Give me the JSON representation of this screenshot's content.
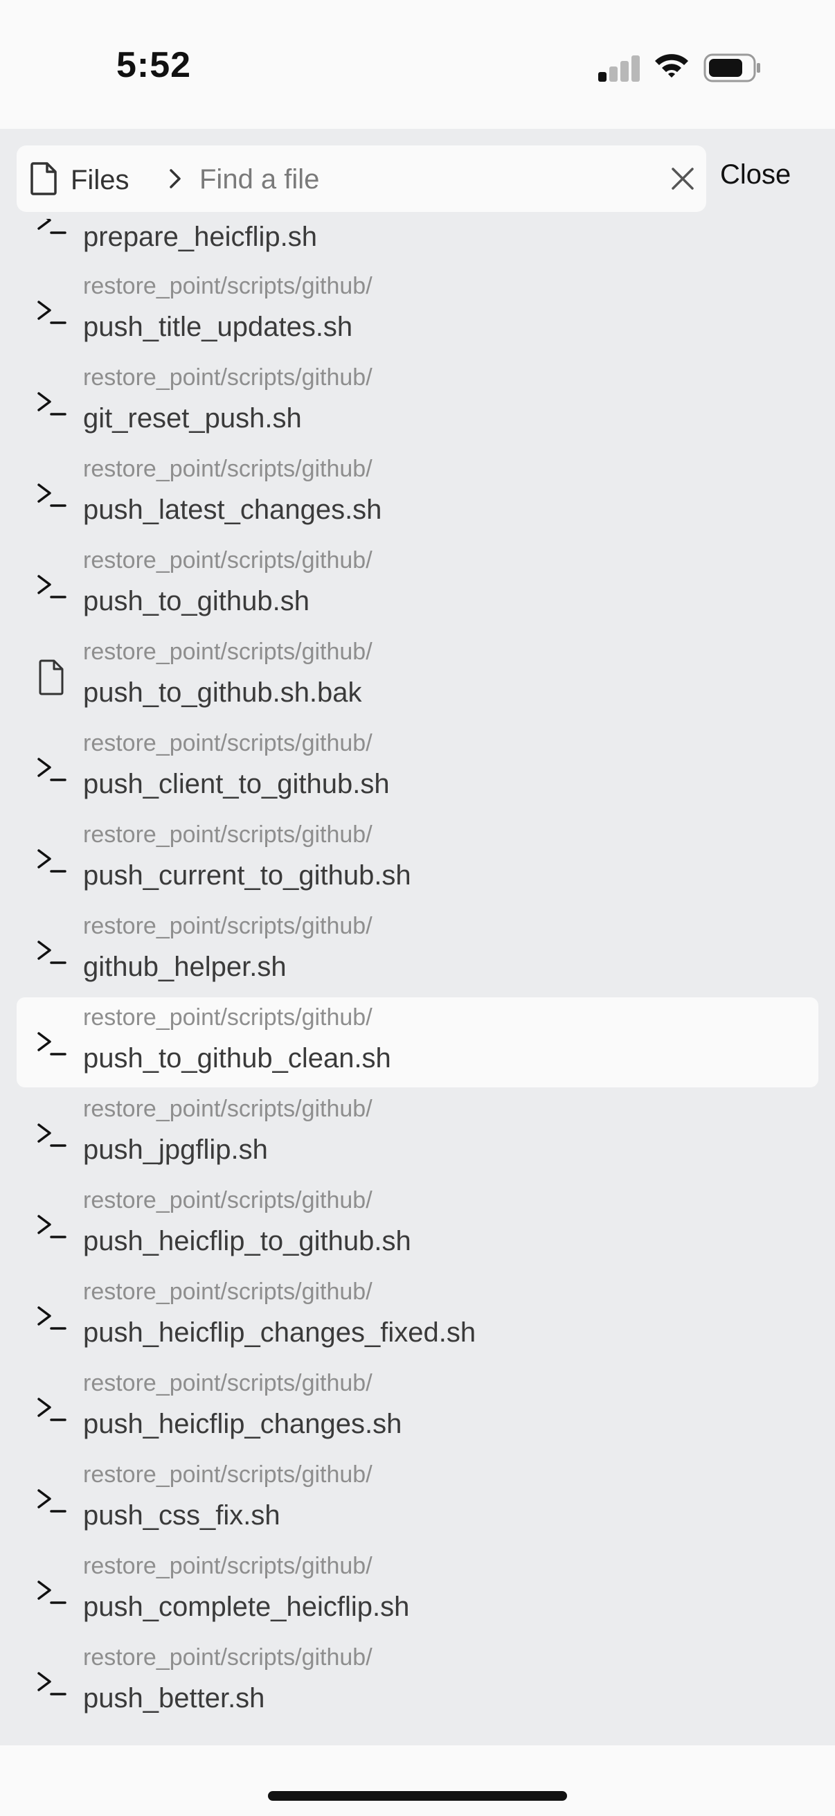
{
  "status_bar": {
    "time": "5:52"
  },
  "search": {
    "files_label": "Files",
    "placeholder": "Find a file",
    "close_label": "Close"
  },
  "list": {
    "first_name": "prepare_heicflip.sh",
    "items": [
      {
        "path": "restore_point/scripts/github/",
        "name": "push_title_updates.sh",
        "icon": "terminal-icon"
      },
      {
        "path": "restore_point/scripts/github/",
        "name": "git_reset_push.sh",
        "icon": "terminal-icon"
      },
      {
        "path": "restore_point/scripts/github/",
        "name": "push_latest_changes.sh",
        "icon": "terminal-icon"
      },
      {
        "path": "restore_point/scripts/github/",
        "name": "push_to_github.sh",
        "icon": "terminal-icon"
      },
      {
        "path": "restore_point/scripts/github/",
        "name": "push_to_github.sh.bak",
        "icon": "file-icon"
      },
      {
        "path": "restore_point/scripts/github/",
        "name": "push_client_to_github.sh",
        "icon": "terminal-icon"
      },
      {
        "path": "restore_point/scripts/github/",
        "name": "push_current_to_github.sh",
        "icon": "terminal-icon"
      },
      {
        "path": "restore_point/scripts/github/",
        "name": "github_helper.sh",
        "icon": "terminal-icon"
      },
      {
        "path": "restore_point/scripts/github/",
        "name": "push_to_github_clean.sh",
        "icon": "terminal-icon",
        "highlighted": true
      },
      {
        "path": "restore_point/scripts/github/",
        "name": "push_jpgflip.sh",
        "icon": "terminal-icon"
      },
      {
        "path": "restore_point/scripts/github/",
        "name": "push_heicflip_to_github.sh",
        "icon": "terminal-icon"
      },
      {
        "path": "restore_point/scripts/github/",
        "name": "push_heicflip_changes_fixed.sh",
        "icon": "terminal-icon"
      },
      {
        "path": "restore_point/scripts/github/",
        "name": "push_heicflip_changes.sh",
        "icon": "terminal-icon"
      },
      {
        "path": "restore_point/scripts/github/",
        "name": "push_css_fix.sh",
        "icon": "terminal-icon"
      },
      {
        "path": "restore_point/scripts/github/",
        "name": "push_complete_heicflip.sh",
        "icon": "terminal-icon"
      },
      {
        "path": "restore_point/scripts/github/",
        "name": "push_better.sh",
        "icon": "terminal-icon"
      }
    ]
  },
  "colors": {
    "background": "#ebecee",
    "surface": "#fafafa",
    "muted_text": "#8e8e8e",
    "text": "#3a3a3a"
  }
}
